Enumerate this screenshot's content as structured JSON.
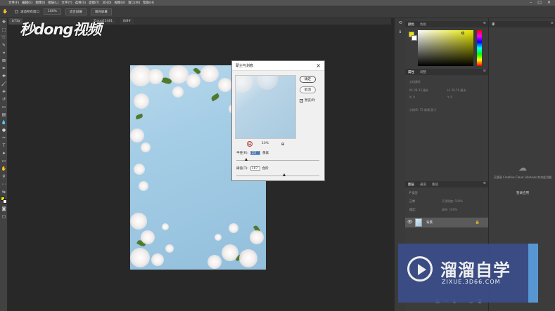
{
  "menubar": {
    "items": [
      "文件(F)",
      "编辑(E)",
      "图像(I)",
      "图层(L)",
      "文字(Y)",
      "选择(S)",
      "滤镜(T)",
      "3D(D)",
      "视图(V)",
      "窗口(W)",
      "帮助(H)"
    ],
    "window_controls": [
      "–",
      "□",
      "✕"
    ]
  },
  "options_bar": {
    "scroll_all_label": "滚动所有窗口",
    "zoom_value": "100%",
    "fit_screen_label": "适合屏幕",
    "fill_screen_label": "填充屏幕"
  },
  "document": {
    "tab_left": "b73a",
    "tab_right": "8/8#",
    "tab_mid": "Ziaug25481"
  },
  "watermark_top": {
    "text": "秒dong视频"
  },
  "dialog": {
    "title": "蒙尘与划痕",
    "ok_label": "确定",
    "cancel_label": "取消",
    "preview_label": "预览(P)",
    "preview_checked": "✓",
    "zoom_value": "10%",
    "zoom_minus": "⊖",
    "zoom_plus": "⊕",
    "radius_label": "半径(R):",
    "radius_value": "23",
    "radius_unit": "像素",
    "threshold_label": "阈值(T):",
    "threshold_value": "107",
    "threshold_unit": "色阶"
  },
  "right_panels": {
    "color_tabs": [
      "颜色",
      "色板"
    ],
    "props_tabs": [
      "属性",
      "调整"
    ],
    "props_subtitle": "文档属性",
    "props_w": "W: 28.33 厘米",
    "props_h": "H: 29.76 厘米",
    "props_x": "X: 0",
    "props_y": "Y: 0",
    "props_res": "分辨率: 72 像素/英寸",
    "layers_tabs": [
      "图层",
      "通道",
      "路径"
    ],
    "layers_kind": "P 类型",
    "layers_mode": "正常",
    "layers_opacity": "不透明度: 100%",
    "layers_lock": "锁定:",
    "layers_fill": "填充: 100%",
    "layer_name": "背景",
    "layer_eye": "👁",
    "layer_lock": "🔒",
    "layer_icons": [
      "⛓",
      "fx",
      "◐",
      "▭",
      "▢",
      "🗑"
    ]
  },
  "libraries": {
    "tab": "库",
    "message": "已登录 Creative Cloud Libraries 的对此功能",
    "link": "登录应用"
  },
  "watermark_bottom": {
    "title": "溜溜自学",
    "url": "ZIXUE.3D66.COM"
  }
}
